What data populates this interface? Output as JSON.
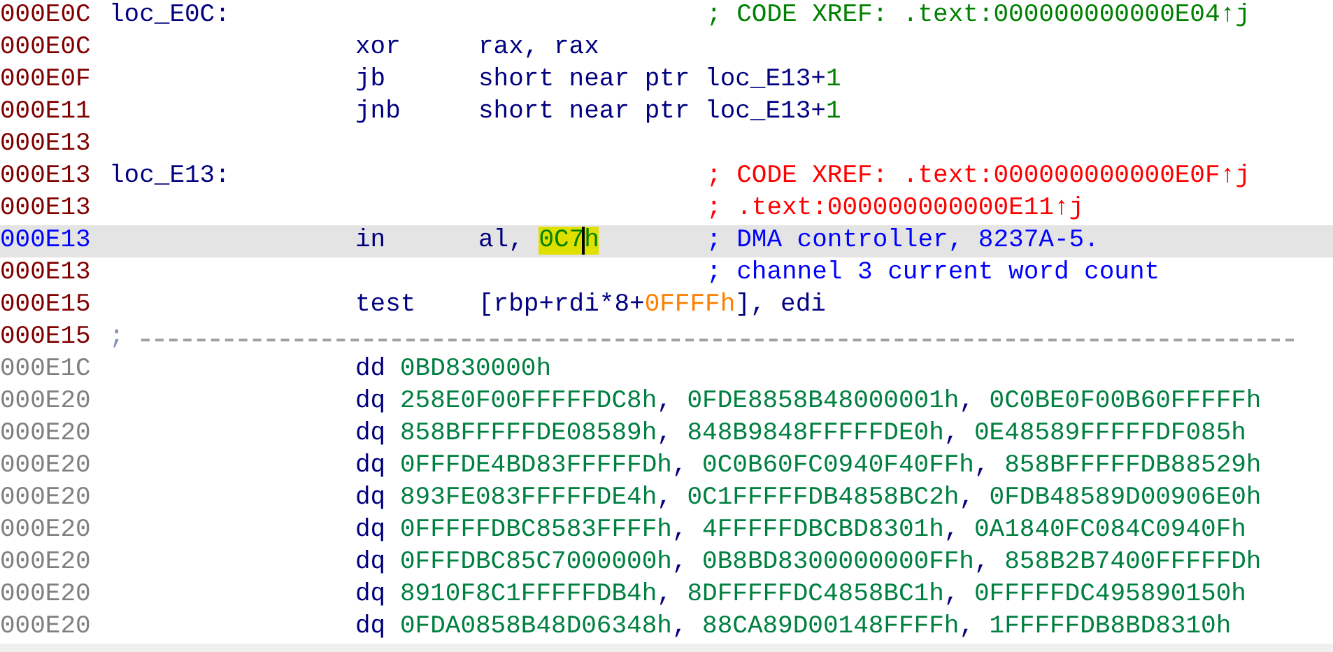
{
  "listing": {
    "rows": [
      {
        "kind": "label",
        "address": "000E0C",
        "selected": false,
        "label": "loc_E0C:",
        "comment": {
          "text": "; CODE XREF: .text:000000000000E04↑j",
          "color": "#008000"
        }
      },
      {
        "kind": "instruction",
        "address": "000E0C",
        "selected": false,
        "mnemonic": "xor",
        "operand": [
          {
            "text": "rax, rax",
            "kind": "plain",
            "highlighted": false,
            "cursor": false
          }
        ]
      },
      {
        "kind": "instruction",
        "address": "000E0F",
        "selected": false,
        "mnemonic": "jb",
        "operand": [
          {
            "text": "short near ptr loc_E13+",
            "kind": "plain",
            "highlighted": false,
            "cursor": false
          },
          {
            "text": "1",
            "kind": "number",
            "highlighted": false,
            "cursor": false
          }
        ]
      },
      {
        "kind": "instruction",
        "address": "000E11",
        "selected": false,
        "mnemonic": "jnb",
        "operand": [
          {
            "text": "short near ptr loc_E13+",
            "kind": "plain",
            "highlighted": false,
            "cursor": false
          },
          {
            "text": "1",
            "kind": "number",
            "highlighted": false,
            "cursor": false
          }
        ]
      },
      {
        "kind": "blank",
        "address": "000E13",
        "selected": false
      },
      {
        "kind": "label",
        "address": "000E13",
        "selected": false,
        "label": "loc_E13:",
        "comment": {
          "text": "; CODE XREF: .text:000000000000E0F↑j",
          "color": "#ff0000"
        }
      },
      {
        "kind": "comment",
        "address": "000E13",
        "selected": false,
        "comment": {
          "text": "; .text:000000000000E11↑j",
          "color": "#ff0000"
        }
      },
      {
        "kind": "instruction",
        "address": "000E13",
        "selected": true,
        "mnemonic": "in",
        "operand": [
          {
            "text": "al, ",
            "kind": "plain",
            "highlighted": false,
            "cursor": false
          },
          {
            "text": "0C7",
            "kind": "number",
            "highlighted": true,
            "cursor": true
          },
          {
            "text": "h",
            "kind": "number",
            "highlighted": true,
            "cursor": false
          }
        ],
        "comment": {
          "text": "; DMA controller, 8237A-5.",
          "color": "#0000ff"
        }
      },
      {
        "kind": "comment",
        "address": "000E13",
        "selected": false,
        "comment": {
          "text": "; channel 3 current word count",
          "color": "#0000ff"
        }
      },
      {
        "kind": "instruction",
        "address": "000E15",
        "selected": false,
        "mnemonic": "test",
        "operand": [
          {
            "text": "[rbp+rdi*8+",
            "kind": "plain",
            "highlighted": false,
            "cursor": false
          },
          {
            "text": "0FFFFh",
            "kind": "offset",
            "highlighted": false,
            "cursor": false
          },
          {
            "text": "], edi",
            "kind": "plain",
            "highlighted": false,
            "cursor": false
          }
        ]
      },
      {
        "kind": "separator",
        "address": "000E15",
        "selected": false,
        "marker": ";"
      },
      {
        "kind": "data",
        "address": "000E1C",
        "selected": false,
        "mnemonic": "dd",
        "operand": [
          {
            "text": "0BD830000h",
            "kind": "data"
          }
        ]
      },
      {
        "kind": "data",
        "address": "000E20",
        "selected": false,
        "mnemonic": "dq",
        "operand": [
          {
            "text": "258E0F00FFFFFDC8h",
            "kind": "data"
          },
          {
            "text": ", ",
            "kind": "plain"
          },
          {
            "text": "0FDE8858B48000001h",
            "kind": "data"
          },
          {
            "text": ", ",
            "kind": "plain"
          },
          {
            "text": "0C0BE0F00B60FFFFFh",
            "kind": "data"
          }
        ]
      },
      {
        "kind": "data",
        "address": "000E20",
        "selected": false,
        "mnemonic": "dq",
        "operand": [
          {
            "text": "858BFFFFFDE08589h",
            "kind": "data"
          },
          {
            "text": ", ",
            "kind": "plain"
          },
          {
            "text": "848B9848FFFFFDE0h",
            "kind": "data"
          },
          {
            "text": ", ",
            "kind": "plain"
          },
          {
            "text": "0E48589FFFFFDF085h",
            "kind": "data"
          }
        ]
      },
      {
        "kind": "data",
        "address": "000E20",
        "selected": false,
        "mnemonic": "dq",
        "operand": [
          {
            "text": "0FFFDE4BD83FFFFFDh",
            "kind": "data"
          },
          {
            "text": ", ",
            "kind": "plain"
          },
          {
            "text": "0C0B60FC0940F40FFh",
            "kind": "data"
          },
          {
            "text": ", ",
            "kind": "plain"
          },
          {
            "text": "858BFFFFFDB88529h",
            "kind": "data"
          }
        ]
      },
      {
        "kind": "data",
        "address": "000E20",
        "selected": false,
        "mnemonic": "dq",
        "operand": [
          {
            "text": "893FE083FFFFFDE4h",
            "kind": "data"
          },
          {
            "text": ", ",
            "kind": "plain"
          },
          {
            "text": "0C1FFFFFDB4858BC2h",
            "kind": "data"
          },
          {
            "text": ", ",
            "kind": "plain"
          },
          {
            "text": "0FDB48589D00906E0h",
            "kind": "data"
          }
        ]
      },
      {
        "kind": "data",
        "address": "000E20",
        "selected": false,
        "mnemonic": "dq",
        "operand": [
          {
            "text": "0FFFFFDBC8583FFFFh",
            "kind": "data"
          },
          {
            "text": ", ",
            "kind": "plain"
          },
          {
            "text": "4FFFFFDBCBD8301h",
            "kind": "data"
          },
          {
            "text": ", ",
            "kind": "plain"
          },
          {
            "text": "0A1840FC084C0940Fh",
            "kind": "data"
          }
        ]
      },
      {
        "kind": "data",
        "address": "000E20",
        "selected": false,
        "mnemonic": "dq",
        "operand": [
          {
            "text": "0FFFDBC85C7000000h",
            "kind": "data"
          },
          {
            "text": ", ",
            "kind": "plain"
          },
          {
            "text": "0B8BD8300000000FFh",
            "kind": "data"
          },
          {
            "text": ", ",
            "kind": "plain"
          },
          {
            "text": "858B2B7400FFFFFDh",
            "kind": "data"
          }
        ]
      },
      {
        "kind": "data",
        "address": "000E20",
        "selected": false,
        "mnemonic": "dq",
        "operand": [
          {
            "text": "8910F8C1FFFFFDB4h",
            "kind": "data"
          },
          {
            "text": ", ",
            "kind": "plain"
          },
          {
            "text": "8DFFFFFDC4858BC1h",
            "kind": "data"
          },
          {
            "text": ", ",
            "kind": "plain"
          },
          {
            "text": "0FFFFFDC495890150h",
            "kind": "data"
          }
        ]
      },
      {
        "kind": "data",
        "address": "000E20",
        "selected": false,
        "mnemonic": "dq",
        "operand": [
          {
            "text": "0FDA0858B48D06348h",
            "kind": "data"
          },
          {
            "text": ", ",
            "kind": "plain"
          },
          {
            "text": "88CA89D00148FFFFh",
            "kind": "data"
          },
          {
            "text": ", ",
            "kind": "plain"
          },
          {
            "text": "1FFFFFDB8BD8310h",
            "kind": "data"
          }
        ]
      }
    ]
  }
}
